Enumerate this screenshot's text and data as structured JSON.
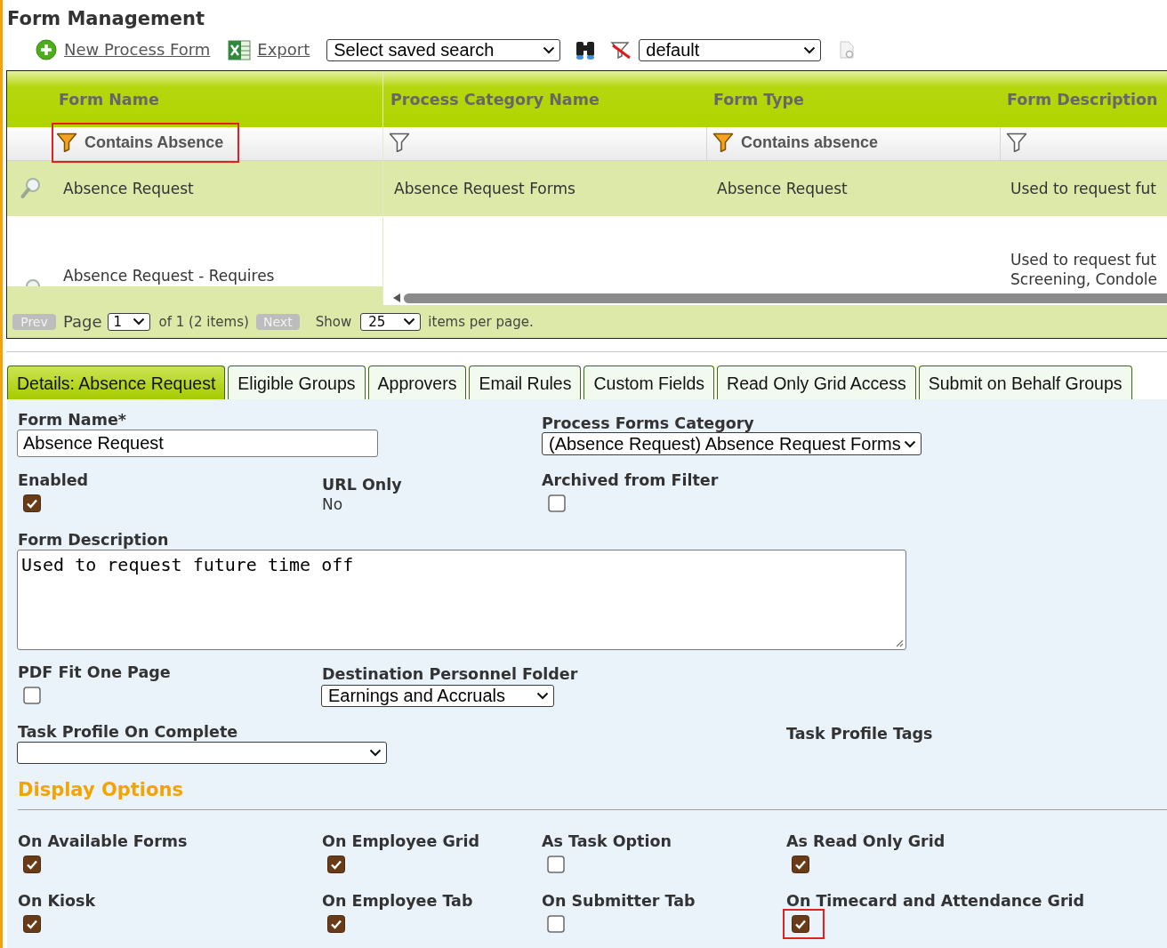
{
  "page": {
    "title": "Form Management"
  },
  "toolbar": {
    "links": [
      {
        "kind": "add",
        "label": "New Process Form"
      },
      {
        "kind": "export",
        "label": "Export"
      }
    ],
    "saved_search": "Select saved search",
    "view": "default"
  },
  "grid": {
    "columns": [
      {
        "label": "Form Name",
        "filter": "Contains Absence",
        "highlighted": true
      },
      {
        "label": "Process Category Name",
        "highlighted": false
      },
      {
        "label": "Form Type",
        "filter": "Contains absence",
        "highlighted": false
      },
      {
        "label": "Form Description",
        "highlighted": false
      }
    ],
    "rows": [
      {
        "selected": true,
        "form_name": "Absence Request",
        "process_category_name": "Absence Request Forms",
        "form_type": "Absence Request",
        "form_description": "Used to request fut"
      },
      {
        "selected": false,
        "form_name": "Absence Request - Requires",
        "form_description": [
          "Used to request fut",
          "Screening, Condole"
        ]
      }
    ]
  },
  "pager": {
    "prev": {
      "label": "Prev",
      "disabled": true
    },
    "page_label": "Page",
    "page": "1",
    "count_text": "of 1 (2 items)",
    "next": {
      "label": "Next",
      "disabled": true
    },
    "show_label": "Show",
    "page_size": "25",
    "per_page_text": "items per page."
  },
  "tabs": [
    {
      "label": "Details: Absence Request",
      "selected": true
    },
    {
      "label": "Eligible Groups",
      "selected": false
    },
    {
      "label": "Approvers",
      "selected": false
    },
    {
      "label": "Email Rules",
      "selected": false
    },
    {
      "label": "Custom Fields",
      "selected": false
    },
    {
      "label": "Read Only Grid Access",
      "selected": false
    },
    {
      "label": "Submit on Behalf Groups",
      "selected": false
    }
  ],
  "details": {
    "form_name": {
      "label": "Form Name*",
      "value": "Absence Request"
    },
    "process_forms_category": {
      "label": "Process Forms Category",
      "value": "(Absence Request) Absence Request Forms"
    },
    "enabled": {
      "label": "Enabled",
      "checked": true
    },
    "url_only": {
      "label": "URL Only",
      "value": "No"
    },
    "archived_from_filter": {
      "label": "Archived from Filter",
      "checked": false
    },
    "form_description": {
      "label": "Form Description",
      "value": "Used to request future time off"
    },
    "pdf_fit_one_page": {
      "label": "PDF Fit One Page",
      "checked": false
    },
    "destination_personnel_folder": {
      "label": "Destination Personnel Folder",
      "value": "Earnings and Accruals"
    },
    "task_profile_on_complete": {
      "label": "Task Profile On Complete"
    },
    "task_profile_tags": {
      "label": "Task Profile Tags"
    }
  },
  "display_options": {
    "title": "Display Options",
    "options": [
      {
        "label": "On Available Forms",
        "checked": true,
        "highlighted": false
      },
      {
        "label": "On Employee Grid",
        "checked": true,
        "highlighted": false
      },
      {
        "label": "As Task Option",
        "checked": false,
        "highlighted": false
      },
      {
        "label": "As Read Only Grid",
        "checked": true,
        "highlighted": false
      },
      {
        "label": "On Kiosk",
        "checked": true,
        "highlighted": false
      },
      {
        "label": "On Employee Tab",
        "checked": true,
        "highlighted": false
      },
      {
        "label": "On Submitter Tab",
        "checked": false,
        "highlighted": false
      },
      {
        "label": "On Timecard and Attendance Grid",
        "checked": true,
        "highlighted": true
      }
    ]
  }
}
